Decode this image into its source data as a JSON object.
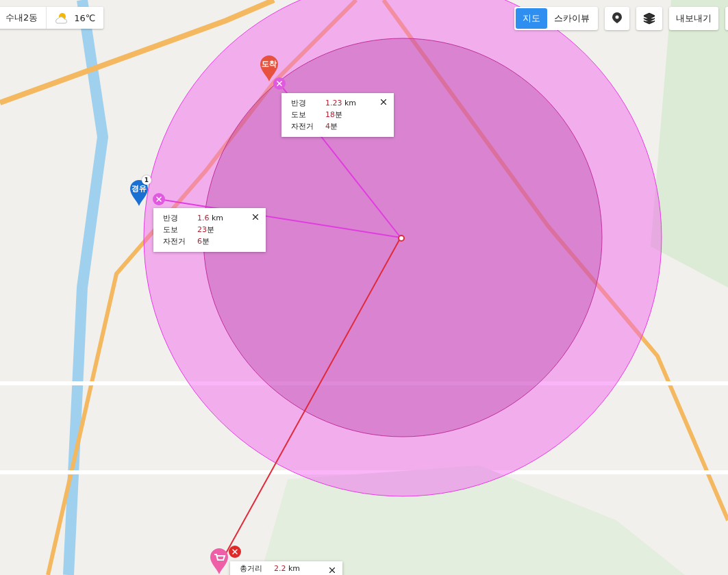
{
  "location": {
    "area": "수내2동",
    "temperature": "16℃"
  },
  "map_type_toggle": [
    {
      "label": "지도",
      "selected": true
    },
    {
      "label": "스카이뷰",
      "selected": false
    }
  ],
  "export_button": "내보내기",
  "markers": [
    {
      "kind": "waypoint",
      "label": "경유",
      "badge": "1"
    },
    {
      "kind": "arrival",
      "label": "도착"
    },
    {
      "kind": "shop"
    }
  ],
  "radius_popups": [
    {
      "rows": [
        {
          "label": "반경",
          "value": "1.23",
          "unit": " km"
        },
        {
          "label": "도보",
          "value": "18",
          "unit": "분"
        },
        {
          "label": "자전거",
          "value": "4",
          "unit": "분"
        }
      ]
    },
    {
      "rows": [
        {
          "label": "반경",
          "value": "1.6",
          "unit": " km"
        },
        {
          "label": "도보",
          "value": "23",
          "unit": "분"
        },
        {
          "label": "자전거",
          "value": "6",
          "unit": "분"
        }
      ]
    },
    {
      "rows": [
        {
          "label": "총거리",
          "value": "2.2",
          "unit": " km"
        }
      ]
    }
  ]
}
